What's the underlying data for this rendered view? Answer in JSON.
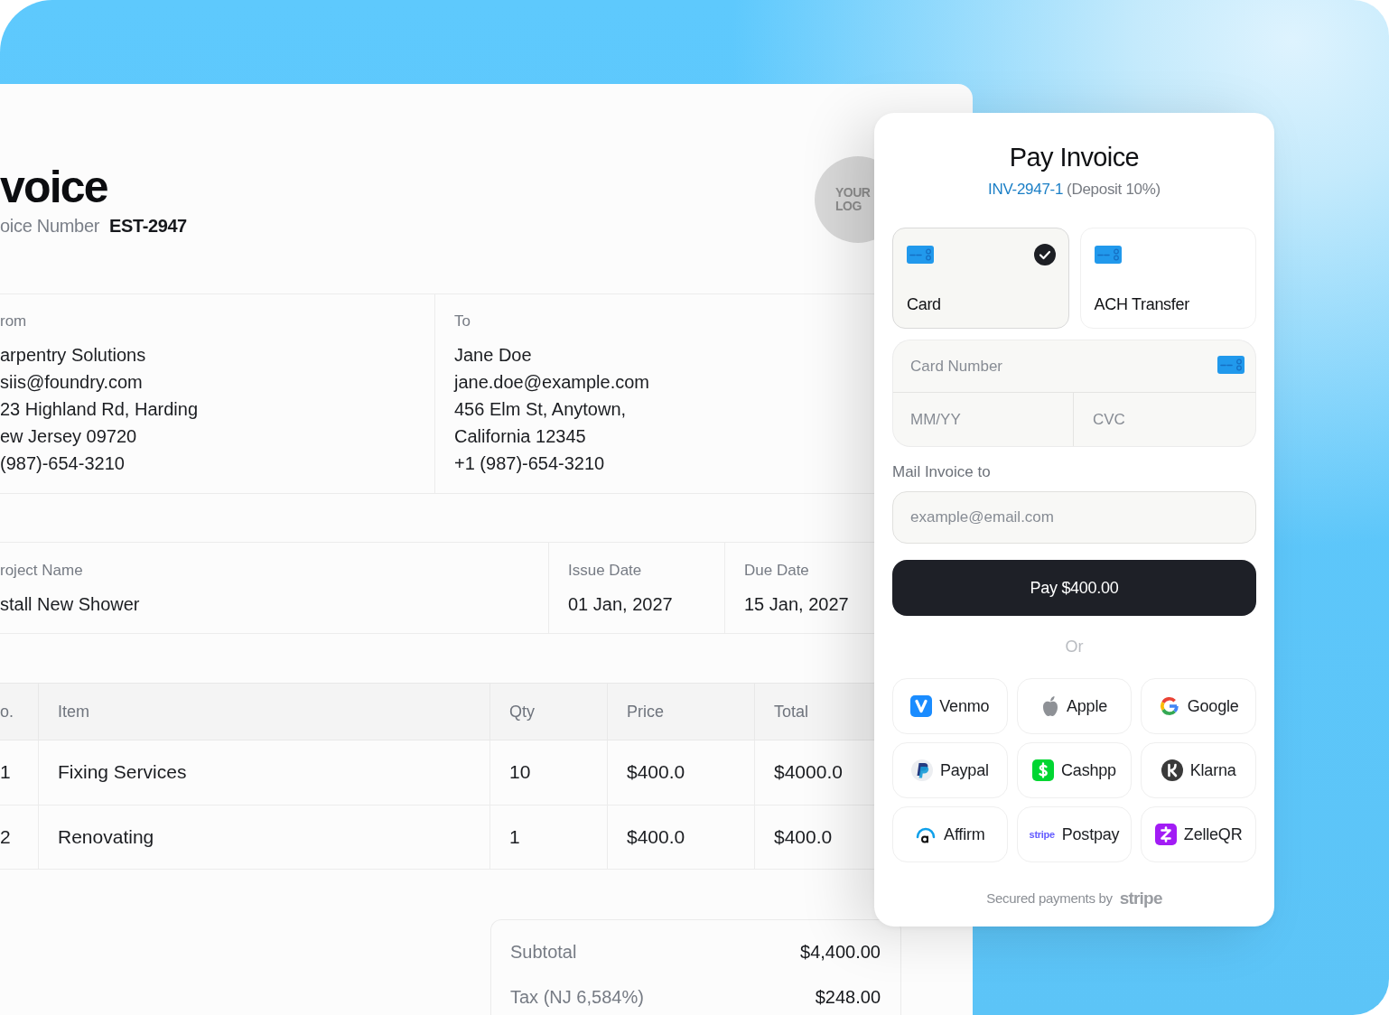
{
  "invoice": {
    "title": "voice",
    "number_label": "oice Number",
    "number": "EST-2947",
    "logo_text": [
      "YOUR",
      "LOG"
    ],
    "parties": [
      {
        "label": "rom",
        "lines": [
          "arpentry Solutions",
          "siis@foundry.com",
          "23 Highland Rd, Harding",
          "ew Jersey 09720",
          "(987)-654-3210"
        ]
      },
      {
        "label": "To",
        "lines": [
          "Jane Doe",
          "jane.doe@example.com",
          "456 Elm St, Anytown,",
          "California 12345",
          "+1 (987)-654-3210"
        ]
      }
    ],
    "details": [
      {
        "label": "roject Name",
        "value": "stall New Shower"
      },
      {
        "label": "Issue Date",
        "value": "01 Jan, 2027"
      },
      {
        "label": "Due Date",
        "value": "15 Jan, 2027"
      }
    ],
    "table": {
      "columns": [
        "o.",
        "Item",
        "Qty",
        "Price",
        "Total"
      ],
      "rows": [
        [
          "1",
          "Fixing Services",
          "10",
          "$400.0",
          "$4000.0"
        ],
        [
          "2",
          "Renovating",
          "1",
          "$400.0",
          "$400.0"
        ]
      ]
    },
    "summary": [
      {
        "label": "Subtotal",
        "value": "$4,400.00"
      },
      {
        "label": "Tax (NJ 6,584%)",
        "value": "$248.00"
      }
    ]
  },
  "payment": {
    "title": "Pay Invoice",
    "invoice_ref": "INV-2947-1",
    "deposit_note": "(Deposit 10%)",
    "methods": [
      {
        "label": "Card",
        "selected": true
      },
      {
        "label": "ACH Transfer",
        "selected": false
      }
    ],
    "card_fields": {
      "number_placeholder": "Card Number",
      "expiry_placeholder": "MM/YY",
      "cvc_placeholder": "CVC"
    },
    "mail_label": "Mail Invoice to",
    "email_placeholder": "example@email.com",
    "pay_button": "Pay $400.00",
    "divider_text": "Or",
    "wallets": [
      {
        "kind": "venmo",
        "label": "Venmo"
      },
      {
        "kind": "apple",
        "label": "Apple"
      },
      {
        "kind": "google",
        "label": "Google"
      },
      {
        "kind": "paypal",
        "label": "Paypal"
      },
      {
        "kind": "cashapp",
        "label": "Cashpp"
      },
      {
        "kind": "klarna",
        "label": "Klarna"
      },
      {
        "kind": "affirm",
        "label": "Affirm"
      },
      {
        "kind": "stripe",
        "label": "Postpay",
        "icon_text": "stripe"
      },
      {
        "kind": "zelle",
        "label": "ZelleQR"
      }
    ],
    "footer": "Secured payments by",
    "footer_brand": "stripe"
  }
}
